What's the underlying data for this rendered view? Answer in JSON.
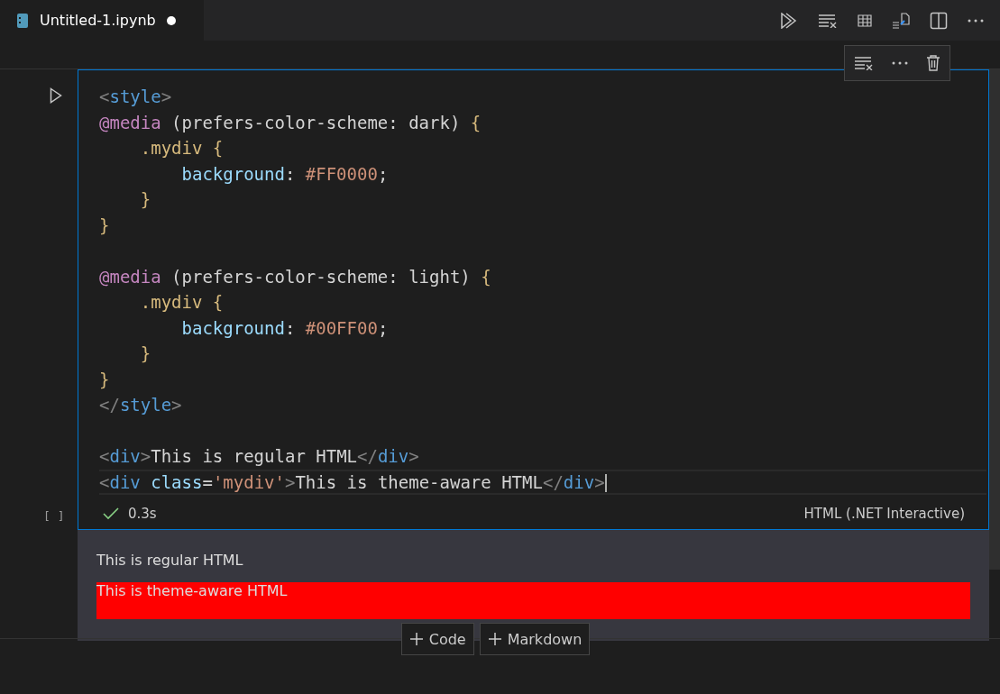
{
  "tab": {
    "title": "Untitled-1.ipynb",
    "dirty": true
  },
  "cell": {
    "status": "0.3s",
    "succeeded": true,
    "execution_count": "[ ]",
    "language": "HTML (.NET Interactive)",
    "code_lines": [
      {
        "tokens": [
          {
            "kind": "punct",
            "text": "<"
          },
          {
            "kind": "tag",
            "text": "style"
          },
          {
            "kind": "punct",
            "text": ">"
          }
        ]
      },
      {
        "tokens": [
          {
            "kind": "at",
            "text": "@media"
          },
          {
            "kind": "text",
            "text": " (prefers-color-scheme: dark) "
          },
          {
            "kind": "sel",
            "text": "{"
          }
        ]
      },
      {
        "tokens": [
          {
            "kind": "sel",
            "text": "    .mydiv {"
          }
        ]
      },
      {
        "tokens": [
          {
            "kind": "prop",
            "text": "        background"
          },
          {
            "kind": "text",
            "text": ": "
          },
          {
            "kind": "val",
            "text": "#FF0000"
          },
          {
            "kind": "text",
            "text": ";"
          }
        ]
      },
      {
        "tokens": [
          {
            "kind": "sel",
            "text": "    }"
          }
        ]
      },
      {
        "tokens": [
          {
            "kind": "sel",
            "text": "}"
          }
        ]
      },
      {
        "gap_before": true,
        "tokens": [
          {
            "kind": "at",
            "text": "@media"
          },
          {
            "kind": "text",
            "text": " (prefers-color-scheme: light) "
          },
          {
            "kind": "sel",
            "text": "{"
          }
        ]
      },
      {
        "tokens": [
          {
            "kind": "sel",
            "text": "    .mydiv {"
          }
        ]
      },
      {
        "tokens": [
          {
            "kind": "prop",
            "text": "        background"
          },
          {
            "kind": "text",
            "text": ": "
          },
          {
            "kind": "val",
            "text": "#00FF00"
          },
          {
            "kind": "text",
            "text": ";"
          }
        ]
      },
      {
        "tokens": [
          {
            "kind": "sel",
            "text": "    }"
          }
        ]
      },
      {
        "tokens": [
          {
            "kind": "sel",
            "text": "}"
          }
        ]
      },
      {
        "tokens": [
          {
            "kind": "punct",
            "text": "</"
          },
          {
            "kind": "tag",
            "text": "style"
          },
          {
            "kind": "punct",
            "text": ">"
          }
        ]
      },
      {
        "gap_before": true,
        "tokens": [
          {
            "kind": "punct",
            "text": "<"
          },
          {
            "kind": "tag",
            "text": "div"
          },
          {
            "kind": "punct",
            "text": ">"
          },
          {
            "kind": "text",
            "text": "This is regular HTML"
          },
          {
            "kind": "punct",
            "text": "</"
          },
          {
            "kind": "tag",
            "text": "div"
          },
          {
            "kind": "punct",
            "text": ">"
          }
        ]
      },
      {
        "cursor": true,
        "tokens": [
          {
            "kind": "punct",
            "text": "<"
          },
          {
            "kind": "tag",
            "text": "div"
          },
          {
            "kind": "attr",
            "text": " class"
          },
          {
            "kind": "text",
            "text": "="
          },
          {
            "kind": "str",
            "text": "'mydiv'"
          },
          {
            "kind": "punct",
            "text": ">"
          },
          {
            "kind": "text",
            "text": "This is theme-aware HTML"
          },
          {
            "kind": "punct",
            "text": "</"
          },
          {
            "kind": "tag",
            "text": "div"
          },
          {
            "kind": "punct",
            "text": ">"
          }
        ]
      }
    ],
    "outputs": [
      {
        "text": "This is regular HTML"
      },
      {
        "text": "This is theme-aware HTML",
        "color": "#ff0000"
      }
    ]
  },
  "add_buttons": [
    {
      "label": "Code"
    },
    {
      "label": "Markdown"
    }
  ]
}
